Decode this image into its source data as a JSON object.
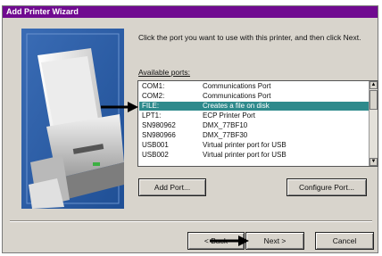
{
  "window": {
    "title": "Add Printer Wizard"
  },
  "instruction": "Click the port you want to use with this printer, and then click Next.",
  "ports": {
    "label": "Available ports:",
    "rows": [
      {
        "port": "COM1:",
        "desc": "Communications Port",
        "selected": false
      },
      {
        "port": "COM2:",
        "desc": "Communications Port",
        "selected": false
      },
      {
        "port": "FILE:",
        "desc": "Creates a file on disk",
        "selected": true
      },
      {
        "port": "LPT1:",
        "desc": "ECP Printer Port",
        "selected": false
      },
      {
        "port": "SN980962",
        "desc": "DMX_77BF10",
        "selected": false
      },
      {
        "port": "SN980966",
        "desc": "DMX_77BF30",
        "selected": false
      },
      {
        "port": "USB001",
        "desc": "Virtual printer port for USB",
        "selected": false
      },
      {
        "port": "USB002",
        "desc": "Virtual printer port for USB",
        "selected": false
      }
    ]
  },
  "buttons": {
    "add_port": "Add Port...",
    "configure_port": "Configure Port...",
    "back": "< Back",
    "next": "Next >",
    "cancel": "Cancel"
  },
  "colors": {
    "titlebar": "#700a90",
    "selection": "#2e8a8c",
    "dialog_face": "#d8d4cc",
    "art_background": "#2d5fa8"
  },
  "icons": {
    "scroll_up": "scroll-up-arrow-icon",
    "scroll_down": "scroll-down-arrow-icon",
    "annotation": "annotation-arrow-icon"
  }
}
